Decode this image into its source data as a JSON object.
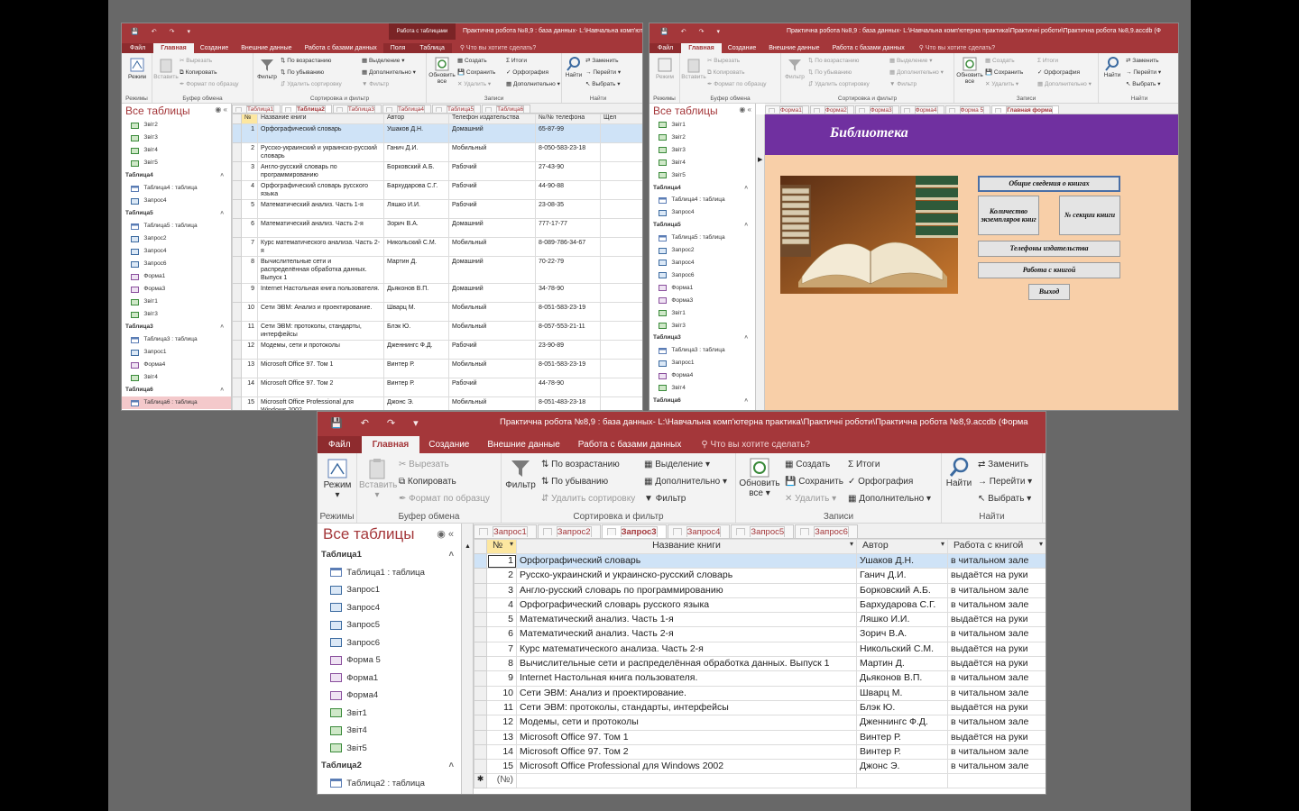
{
  "colors": {
    "accent": "#a4373a",
    "ribbon": "#f3f3f3",
    "selected_row": "#cfe3f7",
    "form_banner": "#7030a0",
    "form_bg": "#f8cfa8"
  },
  "ribbon_common": {
    "tabs": [
      "Файл",
      "Главная",
      "Создание",
      "Внешние данные",
      "Работа с базами данных"
    ],
    "tell_me": "Что вы хотите сделать?",
    "view": {
      "label": "Режим",
      "group": "Режимы"
    },
    "clipboard": {
      "paste": "Вставить",
      "cut": "Вырезать",
      "copy": "Копировать",
      "format": "Формат по образцу",
      "group": "Буфер обмена"
    },
    "sort": {
      "filter": "Фильтр",
      "asc": "По возрастанию",
      "desc": "По убыванию",
      "remove": "Удалить сортировку",
      "selection": "Выделение",
      "advanced": "Дополнительно",
      "toggle": "Фильтр",
      "group": "Сортировка и фильтр"
    },
    "records": {
      "refresh": "Обновить все",
      "new": "Создать",
      "save": "Сохранить",
      "delete": "Удалить",
      "totals": "Итоги",
      "spelling": "Орфография",
      "more": "Дополнительно",
      "group": "Записи"
    },
    "find": {
      "find": "Найти",
      "replace": "Заменить",
      "goto": "Перейти",
      "select": "Выбрать",
      "group": "Найти"
    }
  },
  "win1": {
    "title": "Практична робота №8,9 : база данных- L:\\Навчальна комп'ютерна практика\\",
    "context_title": "Работа с таблицами",
    "context_tabs": [
      "Поля",
      "Таблица"
    ],
    "nav_header": "Все таблицы",
    "nav": [
      {
        "type": "report",
        "label": "Звіт2"
      },
      {
        "type": "report",
        "label": "Звіт3"
      },
      {
        "type": "report",
        "label": "Звіт4"
      },
      {
        "type": "report",
        "label": "Звіт5"
      },
      {
        "type": "section",
        "label": "Таблица4"
      },
      {
        "type": "table",
        "label": "Таблица4 : таблица"
      },
      {
        "type": "query",
        "label": "Запрос4"
      },
      {
        "type": "section",
        "label": "Таблица5"
      },
      {
        "type": "table",
        "label": "Таблица5 : таблица"
      },
      {
        "type": "query",
        "label": "Запрос2"
      },
      {
        "type": "query",
        "label": "Запрос4"
      },
      {
        "type": "query",
        "label": "Запрос6"
      },
      {
        "type": "form",
        "label": "Форма1"
      },
      {
        "type": "form",
        "label": "Форма3"
      },
      {
        "type": "report",
        "label": "Звіт1"
      },
      {
        "type": "report",
        "label": "Звіт3"
      },
      {
        "type": "section",
        "label": "Таблица3"
      },
      {
        "type": "table",
        "label": "Таблица3 : таблица"
      },
      {
        "type": "query",
        "label": "Запрос1"
      },
      {
        "type": "form",
        "label": "Форма4"
      },
      {
        "type": "report",
        "label": "Звіт4"
      },
      {
        "type": "section",
        "label": "Таблица6"
      },
      {
        "type": "table",
        "label": "Таблица6 : таблица",
        "selected": true
      },
      {
        "type": "query",
        "label": "Запрос3"
      }
    ],
    "doc_tabs": [
      "Таблица1",
      "Таблица2",
      "Таблица3",
      "Таблица4",
      "Таблица5",
      "Таблица6"
    ],
    "active_tab": "Таблица2",
    "columns": [
      "№",
      "Название книги",
      "Автор",
      "Телефон издательства",
      "№/№ телефона",
      "Щел"
    ],
    "rows": [
      [
        "1",
        "Орфографический словарь",
        "Ушаков Д.Н.",
        "Домашний",
        "65-87-99"
      ],
      [
        "2",
        "Русско-украинский и украинско-русский словарь",
        "Ганич Д.И.",
        "Мобильный",
        "8-050-583-23-18"
      ],
      [
        "3",
        "Англо-русский словарь по программированию",
        "Борковский А.Б.",
        "Рабочий",
        "27-43-90"
      ],
      [
        "4",
        "Орфографический словарь русского языка",
        "Бархударова С.Г.",
        "Рабочий",
        "44-90-88"
      ],
      [
        "5",
        "Математический анализ. Часть 1-я",
        "Ляшко И.И.",
        "Рабочий",
        "23-08-35"
      ],
      [
        "6",
        "Математический анализ. Часть 2-я",
        "Зорич В.А.",
        "Домашний",
        "777-17-77"
      ],
      [
        "7",
        "Курс математического анализа. Часть 2-я",
        "Никольский С.М.",
        "Мобильный",
        "8-089-786-34-67"
      ],
      [
        "8",
        "Вычислительные сети и распределённая обработка данных. Выпуск 1",
        "Мартин Д.",
        "Домашний",
        "70-22-79"
      ],
      [
        "9",
        "Internet Настольная книга пользователя.",
        "Дьяконов В.П.",
        "Домашний",
        "34-78-90"
      ],
      [
        "10",
        "Сети ЭВМ: Анализ и проектирование.",
        "Шварц М.",
        "Мобильный",
        "8-051-583-23-19"
      ],
      [
        "11",
        "Сети ЭВМ: протоколы, стандарты, интерфейсы",
        "Блэк Ю.",
        "Мобильный",
        "8-057-553-21-11"
      ],
      [
        "12",
        "Модемы, сети и протоколы",
        "Дженнингс Ф.Д.",
        "Рабочий",
        "23-90-89"
      ],
      [
        "13",
        "Microsoft Office 97. Том 1",
        "Винтер Р.",
        "Мобильный",
        "8-051-583-23-19"
      ],
      [
        "14",
        "Microsoft Office 97. Том 2",
        "Винтер Р.",
        "Рабочий",
        "44-78-90"
      ],
      [
        "15",
        "Microsoft Office Professional для Windows 2002",
        "Джонс Э.",
        "Мобильный",
        "8-051-483-23-18"
      ]
    ]
  },
  "win2": {
    "title": "Практична робота №8,9 : база данных- L:\\Навчальна комп'ютерна практика\\Практичні роботи\\Практична робота №8,9.accdb (Ф",
    "nav_header": "Все таблицы",
    "nav": [
      {
        "type": "report",
        "label": "Звіт1"
      },
      {
        "type": "report",
        "label": "Звіт2"
      },
      {
        "type": "report",
        "label": "Звіт3"
      },
      {
        "type": "report",
        "label": "Звіт4"
      },
      {
        "type": "report",
        "label": "Звіт5"
      },
      {
        "type": "section",
        "label": "Таблица4"
      },
      {
        "type": "table",
        "label": "Таблица4 : таблица"
      },
      {
        "type": "query",
        "label": "Запрос4"
      },
      {
        "type": "section",
        "label": "Таблица5"
      },
      {
        "type": "table",
        "label": "Таблица5 : таблица"
      },
      {
        "type": "query",
        "label": "Запрос2"
      },
      {
        "type": "query",
        "label": "Запрос4"
      },
      {
        "type": "query",
        "label": "Запрос6"
      },
      {
        "type": "form",
        "label": "Форма1"
      },
      {
        "type": "form",
        "label": "Форма3"
      },
      {
        "type": "report",
        "label": "Звіт1"
      },
      {
        "type": "report",
        "label": "Звіт3"
      },
      {
        "type": "section",
        "label": "Таблица3"
      },
      {
        "type": "table",
        "label": "Таблица3 : таблица"
      },
      {
        "type": "query",
        "label": "Запрос1"
      },
      {
        "type": "form",
        "label": "Форма4"
      },
      {
        "type": "report",
        "label": "Звіт4"
      },
      {
        "type": "section",
        "label": "Таблица6"
      },
      {
        "type": "table",
        "label": "Таблица6 : таблица"
      }
    ],
    "doc_tabs": [
      "Форма1",
      "Форма2",
      "Форма3",
      "Форма4",
      "Форма 5",
      "Главная форма"
    ],
    "active_tab": "Главная форма",
    "form_title": "Библиотека",
    "buttons": {
      "general": "Общие сведения о книгах",
      "count": "Количество экземпляров книг",
      "section": "№ секции книги",
      "phones": "Телефоны издательства",
      "work": "Работа с книгой",
      "exit": "Выход"
    }
  },
  "win3": {
    "title": "Практична робота №8,9 : база данных- L:\\Навчальна комп'ютерна практика\\Практичні роботи\\Практична робота №8,9.accdb (Форма",
    "nav_header": "Все таблицы",
    "nav": [
      {
        "type": "section",
        "label": "Таблица1"
      },
      {
        "type": "table",
        "label": "Таблица1 : таблица"
      },
      {
        "type": "query",
        "label": "Запрос1"
      },
      {
        "type": "query",
        "label": "Запрос4"
      },
      {
        "type": "query",
        "label": "Запрос5"
      },
      {
        "type": "query",
        "label": "Запрос6"
      },
      {
        "type": "form",
        "label": "Форма 5"
      },
      {
        "type": "form",
        "label": "Форма1"
      },
      {
        "type": "form",
        "label": "Форма4"
      },
      {
        "type": "report",
        "label": "Звіт1"
      },
      {
        "type": "report",
        "label": "Звіт4"
      },
      {
        "type": "report",
        "label": "Звіт5"
      },
      {
        "type": "section",
        "label": "Таблица2"
      },
      {
        "type": "table",
        "label": "Таблица2 : таблица"
      },
      {
        "type": "query",
        "label": "Запрос1"
      }
    ],
    "doc_tabs": [
      "Запрос1",
      "Запрос2",
      "Запрос3",
      "Запрос4",
      "Запрос5",
      "Запрос6"
    ],
    "active_tab": "Запрос3",
    "columns": [
      "№",
      "Название книги",
      "Автор",
      "Работа с книгой"
    ],
    "rows": [
      [
        "1",
        "Орфографический словарь",
        "Ушаков Д.Н.",
        "в читальном зале"
      ],
      [
        "2",
        "Русско-украинский и украинско-русский словарь",
        "Ганич Д.И.",
        "выдаётся на руки"
      ],
      [
        "3",
        "Англо-русский словарь по программированию",
        "Борковский А.Б.",
        "в читальном зале"
      ],
      [
        "4",
        "Орфографический словарь русского языка",
        "Бархударова С.Г.",
        "в читальном зале"
      ],
      [
        "5",
        "Математический анализ. Часть 1-я",
        "Ляшко И.И.",
        "выдаётся на руки"
      ],
      [
        "6",
        "Математический анализ. Часть 2-я",
        "Зорич В.А.",
        "в читальном зале"
      ],
      [
        "7",
        "Курс математического анализа. Часть 2-я",
        "Никольский С.М.",
        "выдаётся на руки"
      ],
      [
        "8",
        "Вычислительные сети и распределённая обработка данных. Выпуск 1",
        "Мартин Д.",
        "выдаётся на руки"
      ],
      [
        "9",
        "Internet Настольная книга пользователя.",
        "Дьяконов В.П.",
        "в читальном зале"
      ],
      [
        "10",
        "Сети ЭВМ: Анализ и проектирование.",
        "Шварц М.",
        "в читальном зале"
      ],
      [
        "11",
        "Сети ЭВМ: протоколы, стандарты, интерфейсы",
        "Блэк Ю.",
        "выдаётся на руки"
      ],
      [
        "12",
        "Модемы, сети и протоколы",
        "Дженнингс Ф.Д.",
        "в читальном зале"
      ],
      [
        "13",
        "Microsoft Office 97. Том 1",
        "Винтер Р.",
        "выдаётся на руки"
      ],
      [
        "14",
        "Microsoft Office 97. Том 2",
        "Винтер Р.",
        "в читальном зале"
      ],
      [
        "15",
        "Microsoft Office Professional для Windows 2002",
        "Джонс Э.",
        "в читальном зале"
      ]
    ],
    "new_row": "(№)"
  }
}
